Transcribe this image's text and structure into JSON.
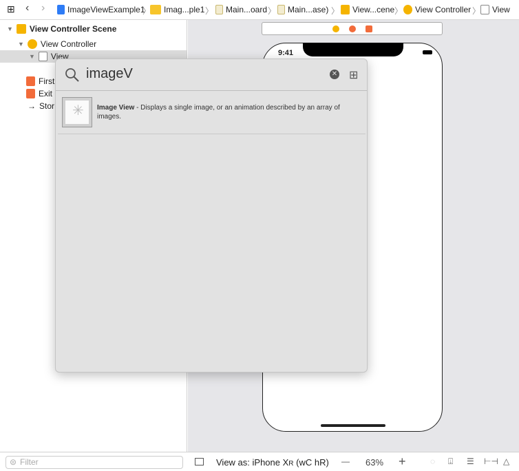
{
  "breadcrumb": [
    "ImageViewExample1",
    "Imag...ple1",
    "Main...oard",
    "Main...ase)",
    "View...cene",
    "View Controller",
    "View"
  ],
  "outline": {
    "scene": "View Controller Scene",
    "controller": "View Controller",
    "view": "View",
    "first": "First",
    "exit": "Exit",
    "story": "Stor"
  },
  "filter_placeholder": "Filter",
  "phone": {
    "time": "9:41"
  },
  "library": {
    "query": "imageV",
    "result_title": "Image View",
    "result_desc": " - Displays a single image, or an animation described by an array of images."
  },
  "bottom": {
    "view_as": "View as: iPhone X",
    "model_suffix": "R",
    "size_class": "(wC hR)",
    "zoom": "63%",
    "minus": "—",
    "plus": "+"
  },
  "colors": {
    "accent_yellow": "#f5b400",
    "orange": "#f26b3a",
    "blue": "#2e7cf6"
  }
}
